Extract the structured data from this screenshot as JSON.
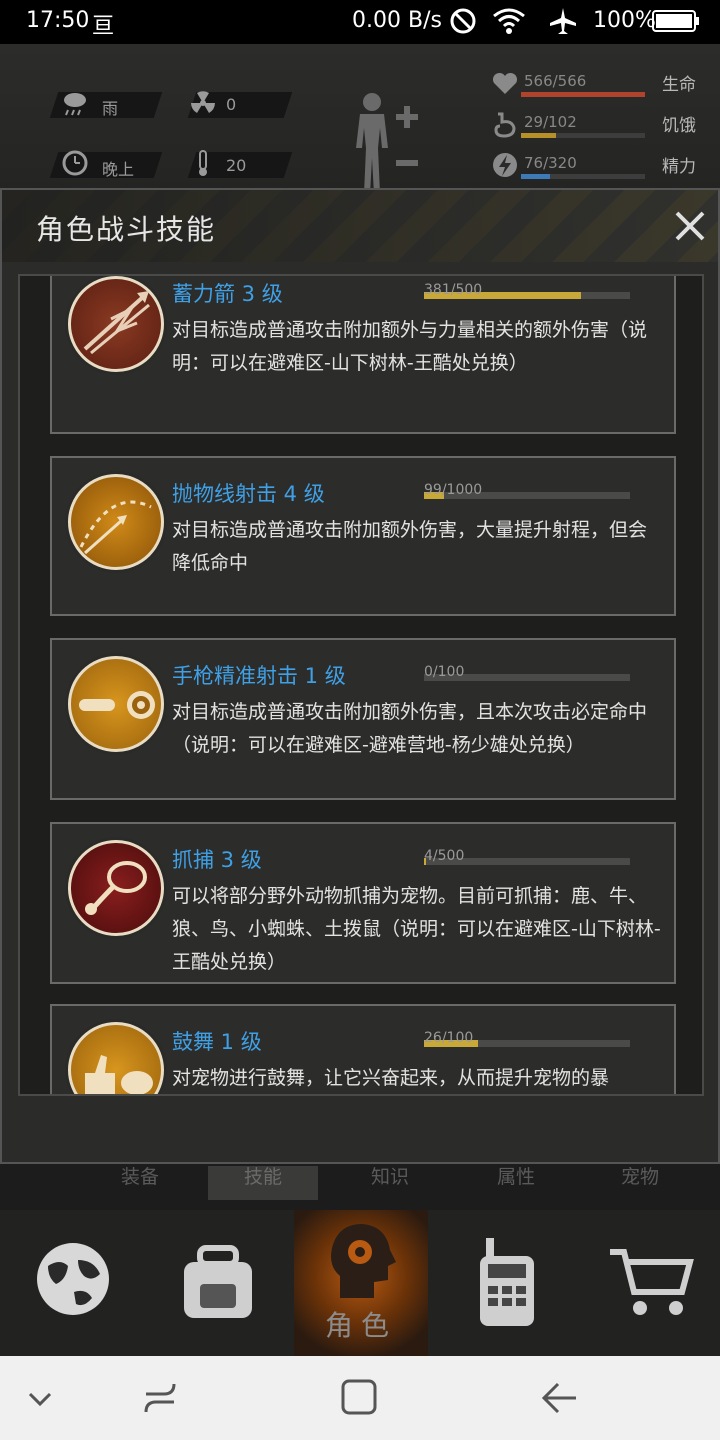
{
  "status_bar": {
    "time": "17:50",
    "notification_glyph": "亘",
    "net_speed": "0.00 B/s",
    "battery": "100%"
  },
  "hud": {
    "weather": "雨",
    "radiation": "0",
    "time_of_day": "晚上",
    "temperature": "20",
    "stats": [
      {
        "label": "生命",
        "value": "566/566",
        "fraction": 1.0,
        "color": "#b0432c"
      },
      {
        "label": "饥饿",
        "value": "29/102",
        "fraction": 0.284,
        "color": "#b8902a"
      },
      {
        "label": "精力",
        "value": "76/320",
        "fraction": 0.2375,
        "color": "#3c7bb8"
      }
    ]
  },
  "panel": {
    "title": "角色战斗技能"
  },
  "skills": [
    {
      "name": "蓄力箭 3 级",
      "progress": "381/500",
      "fraction": 0.762,
      "desc": "对目标造成普通攻击附加额外与力量相关的额外伤害（说明：可以在避难区-山下树林-王酷处兑换）",
      "icon": "bow-arrows-icon"
    },
    {
      "name": "抛物线射击 4 级",
      "progress": "99/1000",
      "fraction": 0.099,
      "desc": "对目标造成普通攻击附加额外伤害，大量提升射程，但会降低命中",
      "icon": "parabola-arrow-icon"
    },
    {
      "name": "手枪精准射击 1 级",
      "progress": "0/100",
      "fraction": 0.0,
      "desc": "对目标造成普通攻击附加额外伤害，且本次攻击必定命中（说明：可以在避难区-避难营地-杨少雄处兑换）",
      "icon": "bullet-target-icon"
    },
    {
      "name": "抓捕 3 级",
      "progress": "4/500",
      "fraction": 0.008,
      "desc": "可以将部分野外动物抓捕为宠物。目前可抓捕：鹿、牛、狼、鸟、小蜘蛛、土拨鼠（说明：可以在避难区-山下树林-王酷处兑换）",
      "icon": "rope-lasso-icon"
    },
    {
      "name": "鼓舞 1 级",
      "progress": "26/100",
      "fraction": 0.26,
      "desc": "对宠物进行鼓舞，让它兴奋起来，从而提升宠物的暴",
      "icon": "thumbs-up-pet-icon"
    }
  ],
  "tabs": [
    "装备",
    "技能",
    "知识",
    "属性",
    "宠物"
  ],
  "bottom_nav": {
    "active_label": "角色"
  },
  "colors": {
    "skill_name": "#3fa0e6",
    "progress_fill": "#c9a83a",
    "nav_active": "#b85a12"
  }
}
